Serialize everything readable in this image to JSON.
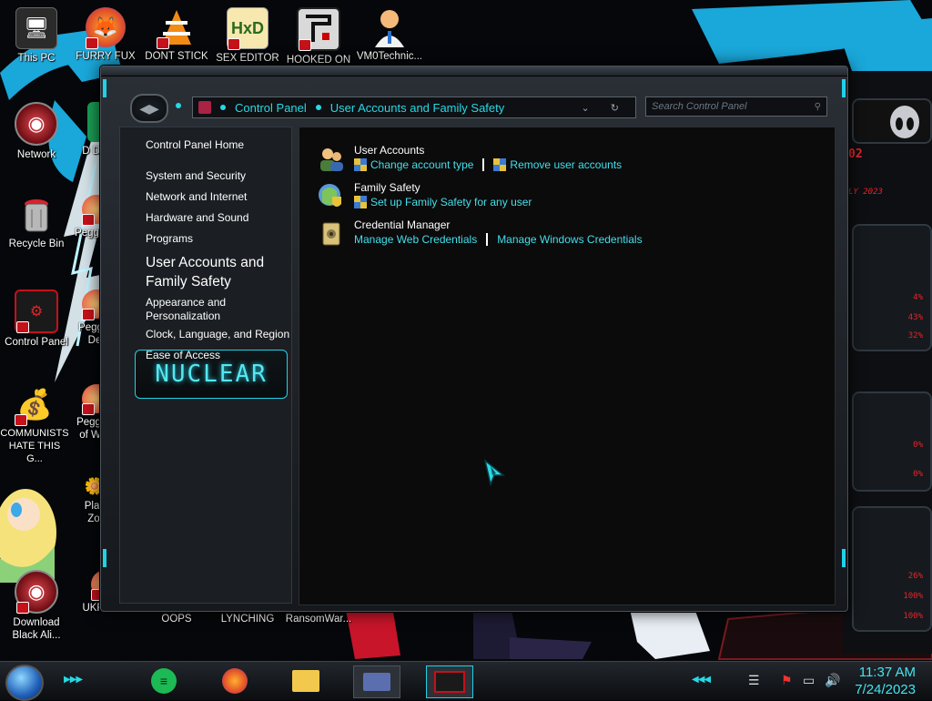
{
  "desktop": {
    "icons": [
      {
        "label": "This PC"
      },
      {
        "label": "FURRY FUX"
      },
      {
        "label": "DONT STICK"
      },
      {
        "label": "SEX EDITOR"
      },
      {
        "label": "HOOKED ON"
      },
      {
        "label": "VM0Technic..."
      },
      {
        "label": "Network"
      },
      {
        "label": "D DUM"
      },
      {
        "label": "Recycle Bin"
      },
      {
        "label": "Peggle"
      },
      {
        "label": "Control Panel"
      },
      {
        "label": "Peggle De"
      },
      {
        "label": "COMMUNISTS HATE THIS G..."
      },
      {
        "label": "Peggle of Wa"
      },
      {
        "label": "Plar Zo"
      },
      {
        "label": "Download Black Ali..."
      },
      {
        "label": "UKRAINE"
      },
      {
        "label": "OOPS"
      },
      {
        "label": "LYNCHING"
      },
      {
        "label": "RansomWar..."
      }
    ]
  },
  "window": {
    "breadcrumb": [
      "Control Panel",
      "User Accounts and Family Safety"
    ],
    "search_placeholder": "Search Control Panel",
    "sidebar": {
      "home": "Control Panel Home",
      "items": [
        "System and Security",
        "Network and Internet",
        "Hardware and Sound",
        "Programs",
        "User Accounts and Family Safety",
        "Appearance and Personalization",
        "Clock, Language, and Region",
        "Ease of Access"
      ],
      "banner": "NUCLEAR"
    },
    "sections": [
      {
        "title": "User Accounts",
        "links": [
          "Change account type",
          "Remove user accounts"
        ]
      },
      {
        "title": "Family Safety",
        "links": [
          "Set up Family Safety for any user"
        ]
      },
      {
        "title": "Credential Manager",
        "links": [
          "Manage Web Credentials",
          "Manage Windows Credentials"
        ]
      }
    ]
  },
  "gadget": {
    "values": [
      "4%",
      "43%",
      "32%",
      "0%",
      "0%",
      "26%",
      "100%",
      "100%"
    ],
    "date_fragment": "LY 2023",
    "top_fragment": "02"
  },
  "taskbar": {
    "time": "11:37 AM",
    "date": "7/24/2023"
  },
  "colors": {
    "accent_cyan": "#27d9e6",
    "link_cyan": "#44dfea",
    "gadget_red": "#e5242b",
    "content_bg": "#0b0b0c"
  }
}
